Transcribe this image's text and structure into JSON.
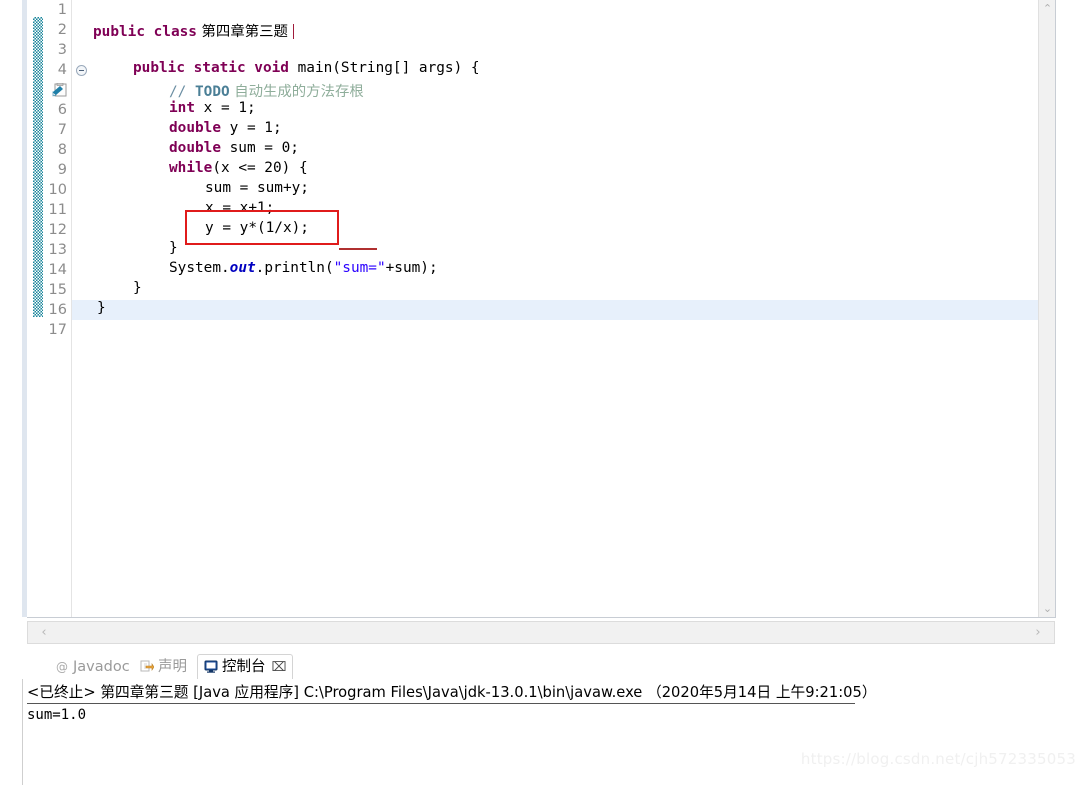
{
  "editor": {
    "first_line": 1,
    "last_line": 17,
    "current_line": 16,
    "fold_marker_line": 4,
    "todo_marker_line": 5,
    "lines": [
      {
        "n": 1,
        "indent": 0,
        "html_key": "l1"
      },
      {
        "n": 2,
        "indent": 0,
        "html_key": "l2"
      },
      {
        "n": 3,
        "indent": 0,
        "html_key": "l3"
      },
      {
        "n": 4,
        "indent": 1,
        "html_key": "l4"
      },
      {
        "n": 5,
        "indent": 2,
        "html_key": "l5"
      },
      {
        "n": 6,
        "indent": 2,
        "html_key": "l6"
      },
      {
        "n": 7,
        "indent": 2,
        "html_key": "l7"
      },
      {
        "n": 8,
        "indent": 2,
        "html_key": "l8"
      },
      {
        "n": 9,
        "indent": 2,
        "html_key": "l9"
      },
      {
        "n": 10,
        "indent": 3,
        "html_key": "l10"
      },
      {
        "n": 11,
        "indent": 3,
        "html_key": "l11"
      },
      {
        "n": 12,
        "indent": 3,
        "html_key": "l12"
      },
      {
        "n": 13,
        "indent": 2,
        "html_key": "l13"
      },
      {
        "n": 14,
        "indent": 2,
        "html_key": "l14"
      },
      {
        "n": 15,
        "indent": 1,
        "html_key": "l15"
      },
      {
        "n": 16,
        "indent": 0,
        "html_key": "l16"
      },
      {
        "n": 17,
        "indent": 0,
        "html_key": "l17"
      }
    ],
    "code": {
      "l1": "",
      "l2_kw": "public class",
      "l2_name": " 第四章第三题 ",
      "l3": "",
      "l4_kw1": "public static void",
      "l4_rest": " main(String[] args) {",
      "l5_slashes": "// ",
      "l5_todo": "TODO",
      "l5_cjk": " 自动生成的方法存根",
      "l6_kw": "int",
      "l6_rest": " x = 1;",
      "l7_kw": "double",
      "l7_rest": " y = 1;",
      "l8_kw": "double",
      "l8_rest": " sum = 0;",
      "l9_kw": "while",
      "l9_rest": "(x <= 20) {",
      "l10": "sum = sum+y;",
      "l11": "x = x+1;",
      "l12": "y = y*(1/x);",
      "l13": "}",
      "l14_a": "System.",
      "l14_out": "out",
      "l14_b": ".println(",
      "l14_str": "\"sum=\"",
      "l14_c": "+sum);",
      "l15": "}",
      "l16": "}",
      "l17": ""
    },
    "annotations": {
      "red_box_target_line": 12,
      "red_box_color": "#e01b1b",
      "red_underline_color": "#b03030"
    },
    "scrollbars": {
      "v_up": "⌃",
      "v_down": "⌄",
      "h_left": "‹",
      "h_right": "›"
    }
  },
  "panel": {
    "tabs": [
      {
        "id": "javadoc",
        "label": "Javadoc",
        "icon": "at-icon",
        "active": false
      },
      {
        "id": "declaration",
        "label": "声明",
        "icon": "declaration-icon",
        "active": false
      },
      {
        "id": "console",
        "label": "控制台",
        "icon": "console-icon",
        "active": true
      }
    ],
    "close_label": "⌧",
    "console": {
      "header": "<已终止> 第四章第三题 [Java 应用程序] C:\\Program Files\\Java\\jdk-13.0.1\\bin\\javaw.exe （2020年5月14日 上午9:21:05）",
      "output": "sum=1.0"
    }
  },
  "watermark": "https://blog.csdn.net/cjh572335053",
  "colors": {
    "keyword": "#7f0055",
    "string": "#2a00ff",
    "comment": "#6c8fa3",
    "field": "#0000c0",
    "change_bar": "#18859b",
    "current_line": "#e7f0fb",
    "line_number": "#8c8c8c",
    "annotation_red": "#e01b1b"
  }
}
